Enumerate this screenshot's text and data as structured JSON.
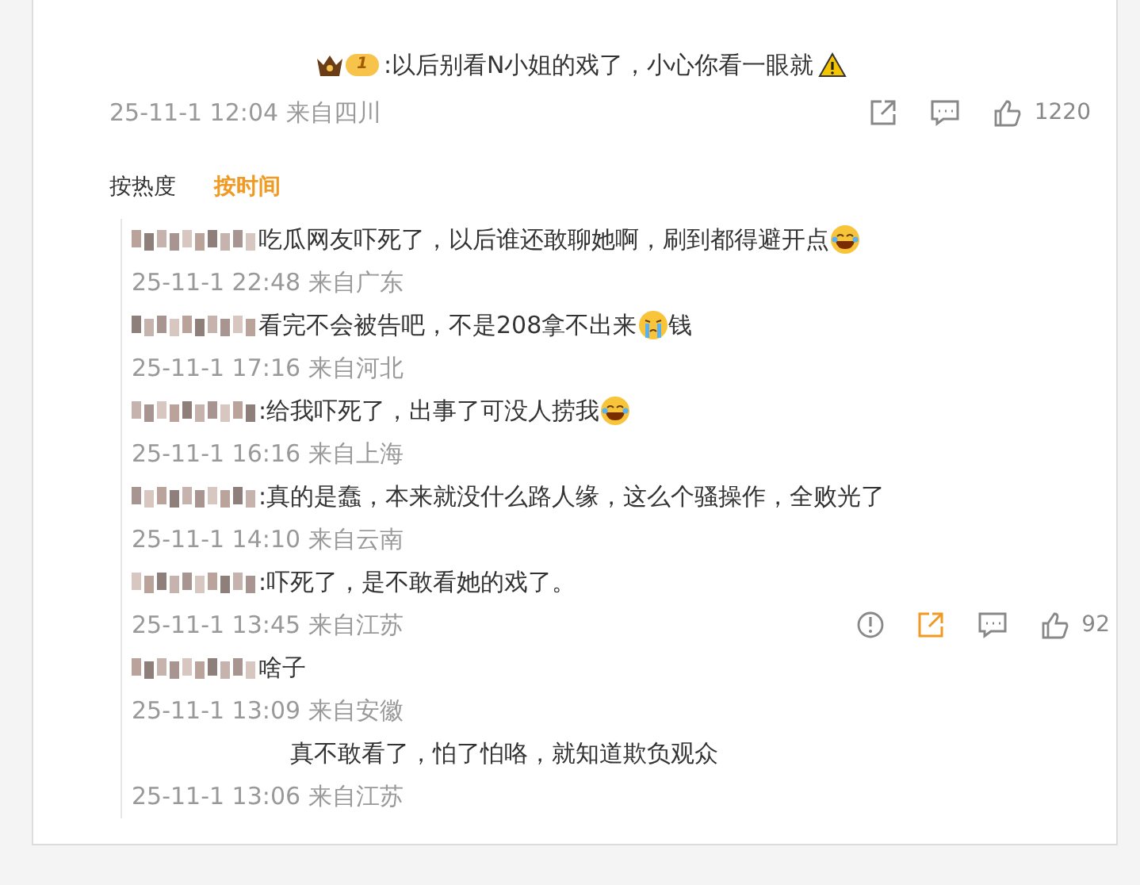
{
  "comment": {
    "badge": "1",
    "text": ":以后别看N小姐的戏了，小心你看一眼就",
    "time": "25-11-1 12:04 来自四川",
    "likes": "1220"
  },
  "sort_tabs": [
    {
      "label": "按热度",
      "selected": false
    },
    {
      "label": "按时间",
      "selected": true
    }
  ],
  "replies": [
    {
      "name_blurred": true,
      "text": "吃瓜网友吓死了，以后谁还敢聊她啊，刷到都得避开点",
      "emoji": {
        "kind": "laugh"
      },
      "time": "25-11-1 22:48 来自广东"
    },
    {
      "name_blurred": true,
      "text": "看完不会被告吧，不是208拿不出来",
      "emoji": {
        "kind": "cry"
      },
      "text_after": "钱",
      "time": "25-11-1 17:16 来自河北"
    },
    {
      "name_blurred": true,
      "text": ":给我吓死了，出事了可没人捞我",
      "emoji": {
        "kind": "laugh"
      },
      "time": "25-11-1 16:16 来自上海"
    },
    {
      "name_blurred": true,
      "text": ":真的是蠢，本来就没什么路人缘，这么个骚操作，全败光了",
      "time": "25-11-1 14:10 来自云南"
    },
    {
      "name_blurred": true,
      "text": ":吓死了，是不敢看她的戏了。",
      "time": "25-11-1 13:45 来自江苏",
      "actions": {
        "likes": "92",
        "share_active": true
      }
    },
    {
      "name_blurred": true,
      "text": "啥子",
      "time": "25-11-1 13:09 来自安徽"
    },
    {
      "name_blurred": false,
      "text": "真不敢看了，怕了怕咯，就知道欺负观众",
      "time": "25-11-1 13:06 来自江苏"
    }
  ]
}
